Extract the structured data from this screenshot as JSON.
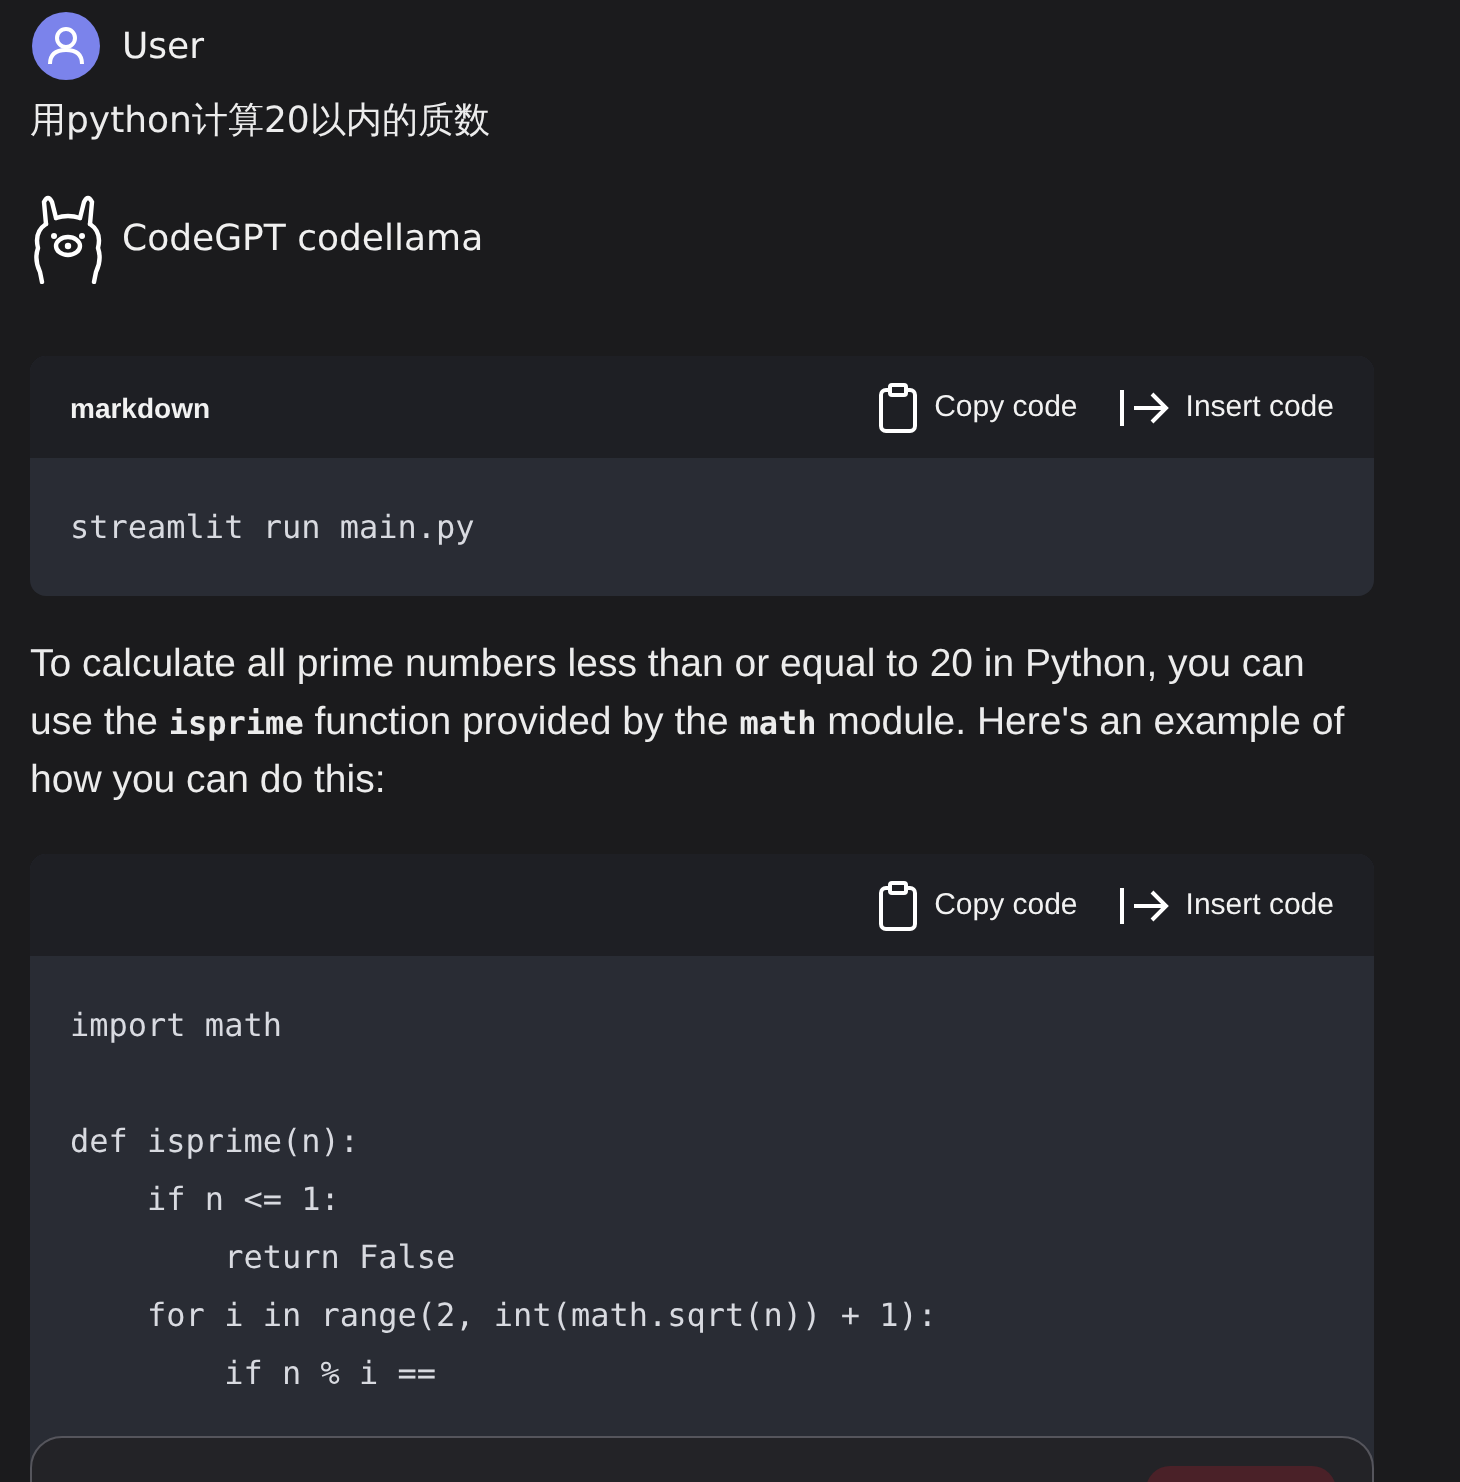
{
  "messages": [
    {
      "kind": "user",
      "author": "User",
      "text": "用python计算20以内的质数"
    },
    {
      "kind": "bot",
      "author": "CodeGPT codellama",
      "blocks": [
        {
          "kind": "code",
          "language": "markdown",
          "actions": [
            "Copy code",
            "Insert code"
          ],
          "code": "streamlit run main.py"
        },
        {
          "kind": "paragraph",
          "text": "To calculate all prime numbers less than or equal to 20 in Python, you can use the **isprime** function provided by the **math** module. Here's an example of how you can do this:"
        },
        {
          "kind": "code",
          "actions": [
            "Copy code",
            "Insert code"
          ],
          "code": "import math\n\ndef isprime(n):\n    if n <= 1:\n        return False\n    for i in range(2, int(math.sqrt(n)) + 1):\n        if n % i =="
        }
      ]
    }
  ],
  "input": {
    "kind": "prompt"
  }
}
